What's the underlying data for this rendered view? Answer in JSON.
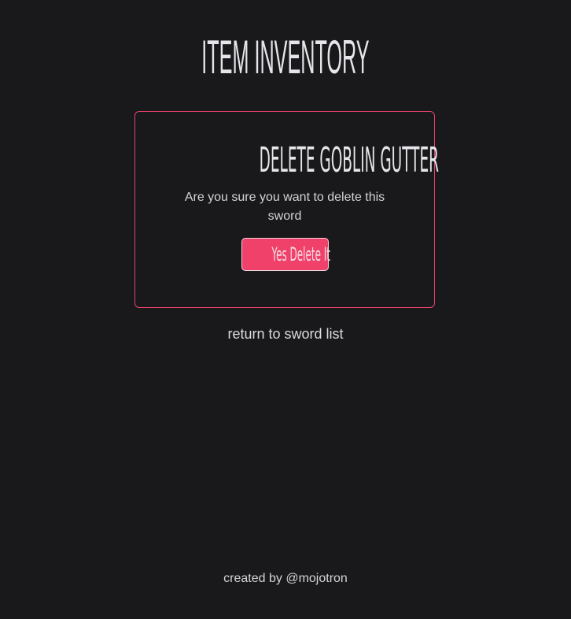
{
  "header": {
    "title": "ITEM INVENTORY"
  },
  "dialog": {
    "title": "DELETE GOBLIN GUTTER",
    "message": "Are you sure you want to delete this sword",
    "confirm_label": "Yes Delete It"
  },
  "nav": {
    "return_label": "return to sword list"
  },
  "footer": {
    "credit": "created by @mojotron"
  },
  "colors": {
    "background": "#19191b",
    "accent": "#f0416a",
    "border": "#e8436a",
    "text": "#d9d9dc"
  }
}
